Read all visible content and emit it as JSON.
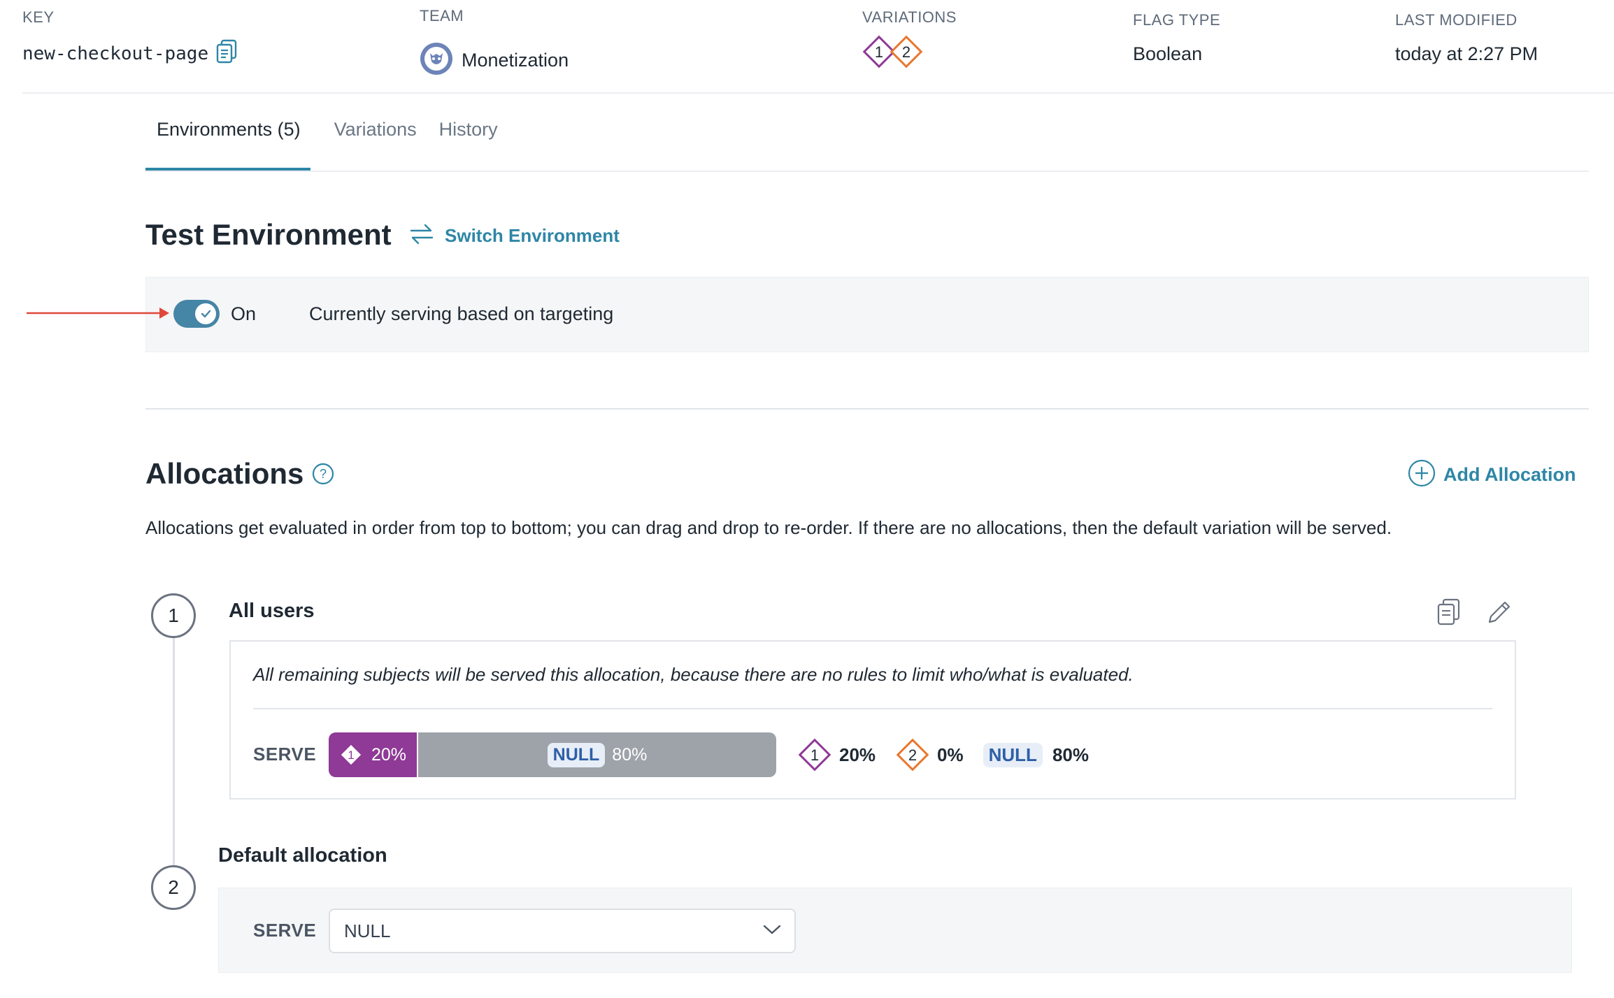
{
  "meta": {
    "key_label": "KEY",
    "key_value": "new-checkout-page",
    "team_label": "TEAM",
    "team_value": "Monetization",
    "variations_label": "VARIATIONS",
    "variation_badges": [
      "1",
      "2"
    ],
    "flag_type_label": "FLAG TYPE",
    "flag_type_value": "Boolean",
    "modified_label": "LAST MODIFIED",
    "modified_value": "today at 2:27 PM"
  },
  "tabs": [
    {
      "label": "Environments (5)",
      "active": true
    },
    {
      "label": "Variations",
      "active": false
    },
    {
      "label": "History",
      "active": false
    }
  ],
  "environment": {
    "title": "Test Environment",
    "switch_label": "Switch Environment",
    "toggle_state": "On",
    "status_text": "Currently serving based on targeting"
  },
  "allocations": {
    "title": "Allocations",
    "add_label": "Add Allocation",
    "description": "Allocations get evaluated in order from top to bottom; you can drag and drop to re-order. If there are no allocations, then the default variation will be served.",
    "items": [
      {
        "number": "1",
        "name": "All users",
        "note": "All remaining subjects will be served this allocation, because there are no rules to limit who/what is evaluated.",
        "serve_label": "SERVE",
        "split": [
          {
            "variation": "1",
            "pct": "20%",
            "fraction": 0.2
          },
          {
            "variation": "NULL",
            "pct": "80%",
            "fraction": 0.8
          }
        ],
        "summary": [
          {
            "variation": "1",
            "pct": "20%"
          },
          {
            "variation": "2",
            "pct": "0%"
          },
          {
            "variation": "NULL",
            "pct": "80%"
          }
        ]
      },
      {
        "number": "2",
        "name": "Default allocation",
        "serve_label": "SERVE",
        "select_value": "NULL"
      }
    ]
  },
  "colors": {
    "accent": "#2e86a6",
    "variation_1": "#8e3a96",
    "variation_2": "#e8772e",
    "null_bar": "#9ea3aa",
    "arrow": "#e0483b"
  }
}
